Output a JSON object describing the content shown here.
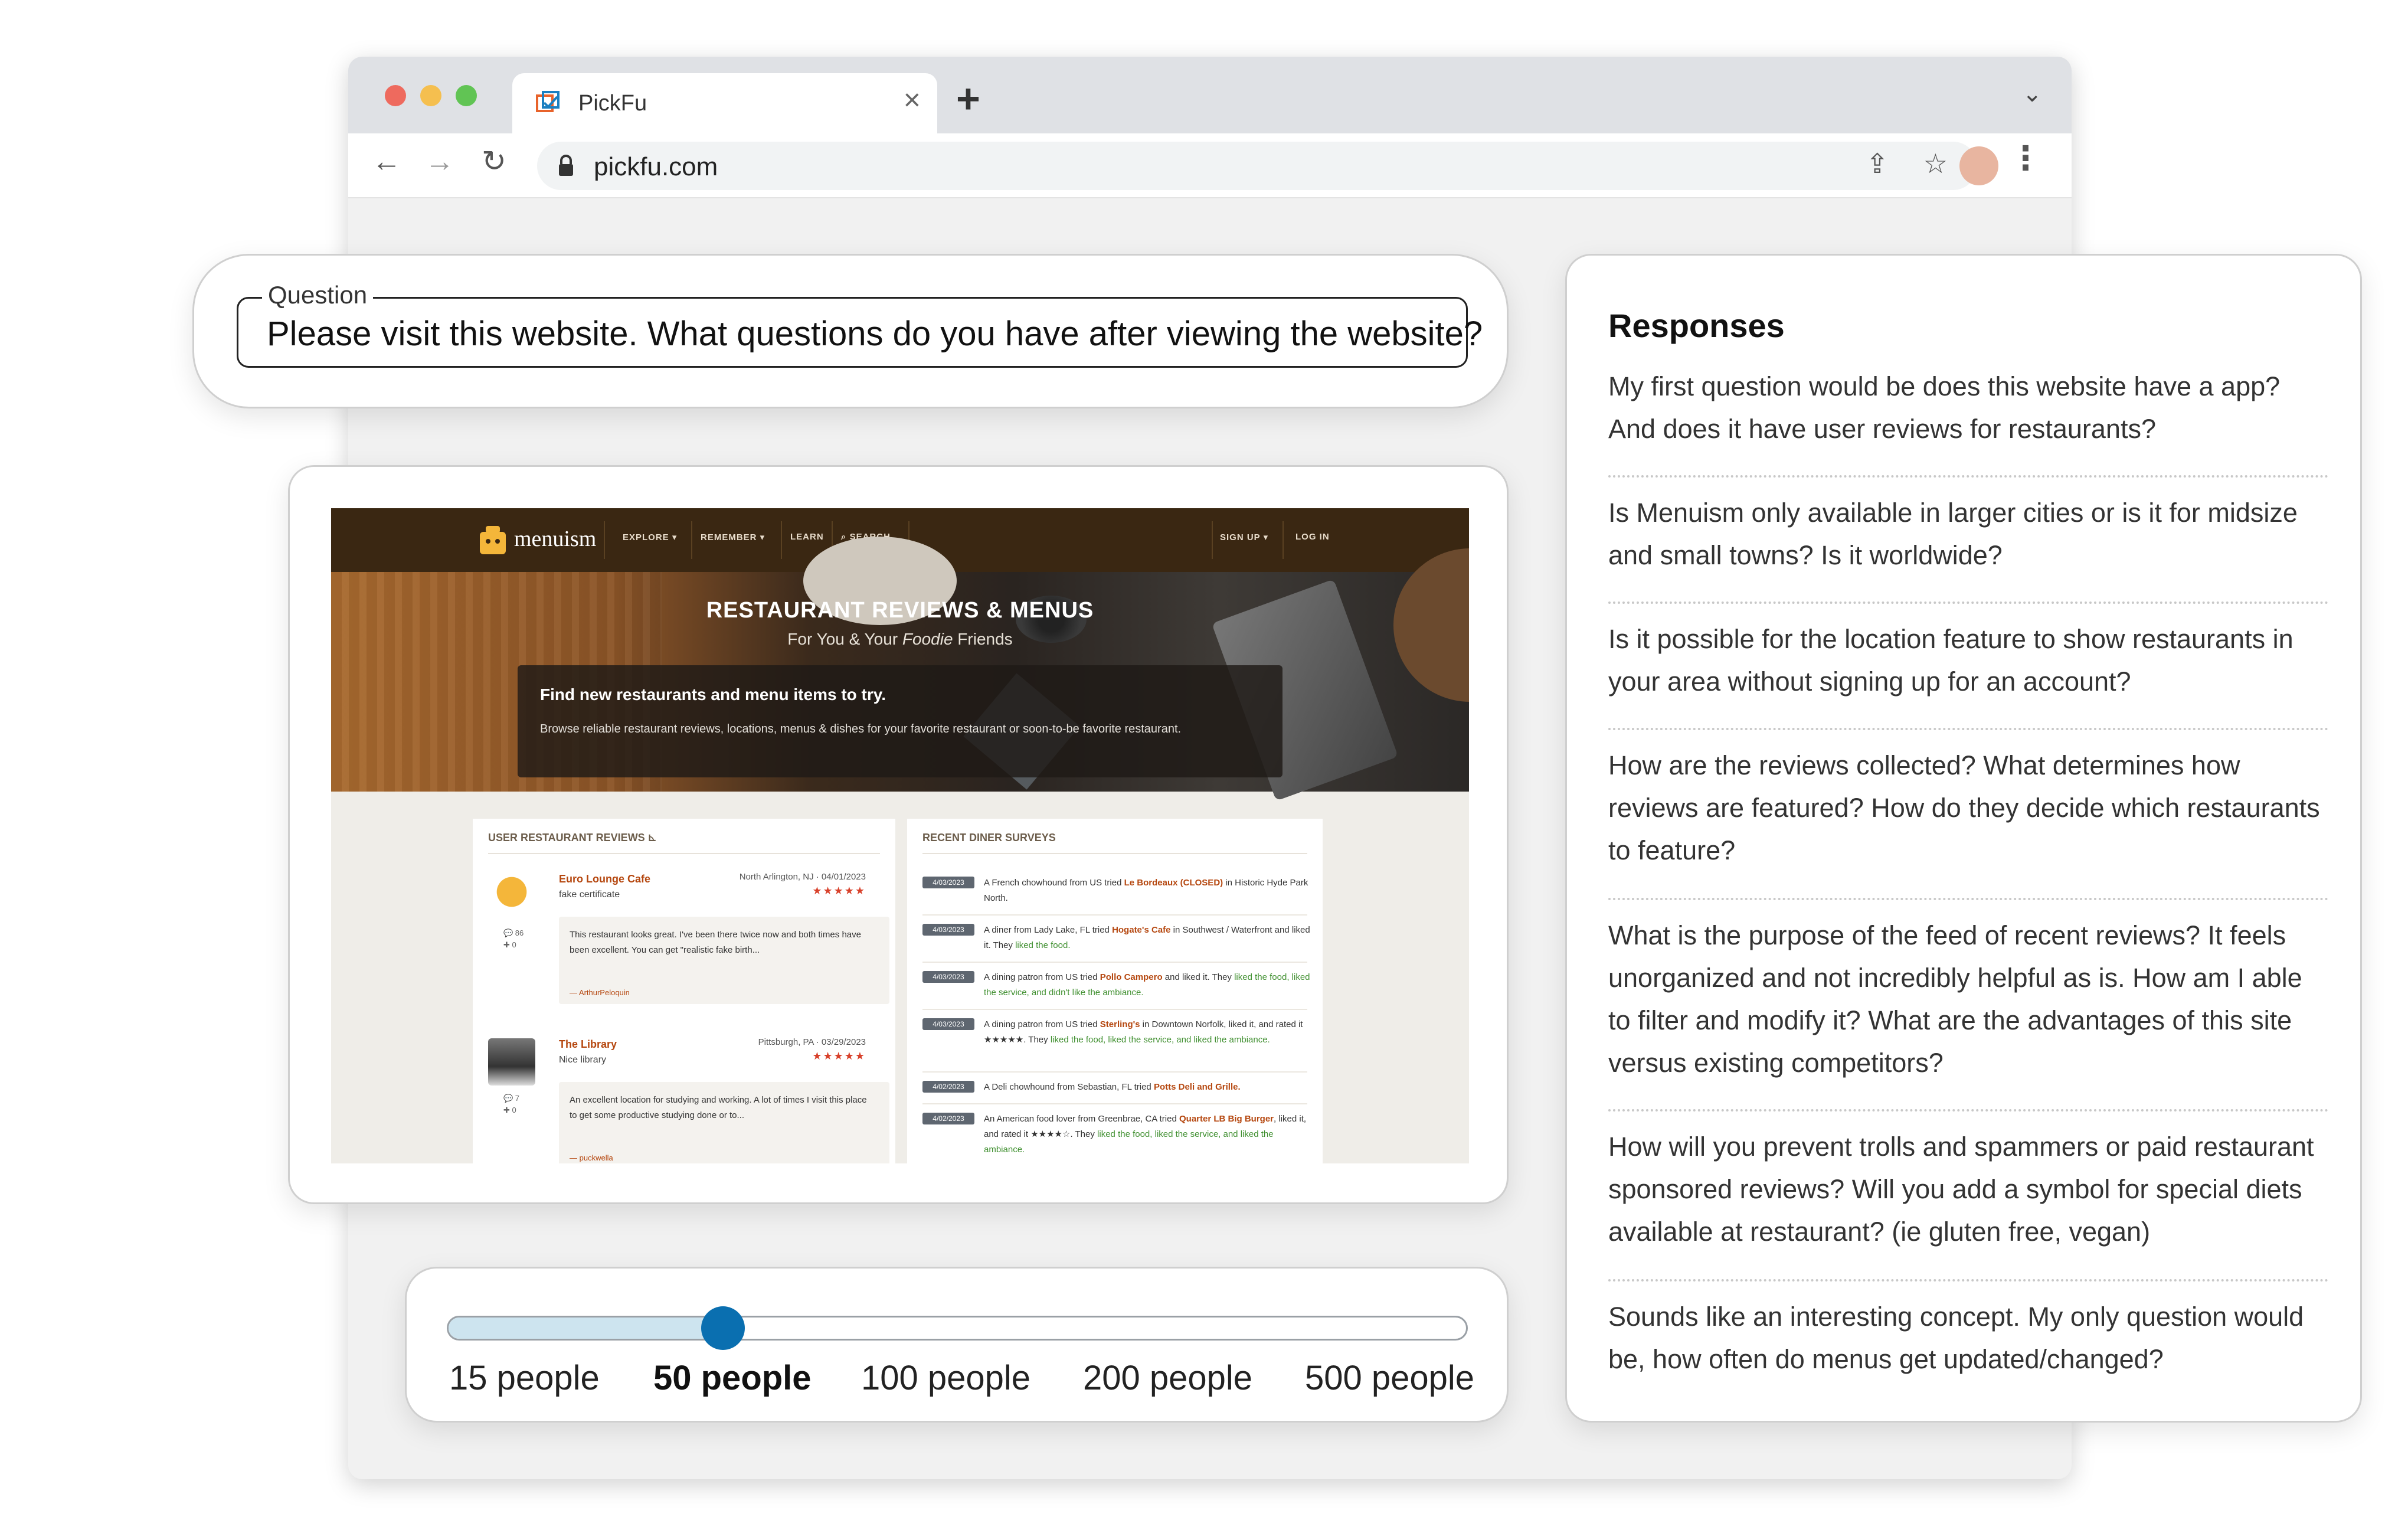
{
  "browser": {
    "tab_title": "PickFu",
    "url": "pickfu.com",
    "icons": [
      "close-icon",
      "plus-icon",
      "chevron-down-icon",
      "back-arrow-icon",
      "forward-arrow-icon",
      "reload-icon",
      "lock-icon",
      "share-icon",
      "star-icon",
      "kebab-menu-icon"
    ]
  },
  "question": {
    "legend": "Question",
    "text": "Please visit this website. What questions do you have after viewing the website?"
  },
  "site": {
    "logo": "menuism",
    "nav": [
      "EXPLORE ▾",
      "REMEMBER ▾",
      "LEARN",
      "⌕ SEARCH"
    ],
    "nav_right": [
      "SIGN UP ▾",
      "LOG IN"
    ],
    "hero_title": "RESTAURANT REVIEWS & MENUS",
    "hero_sub_pre": "For You & Your ",
    "hero_sub_em": "Foodie",
    "hero_sub_post": " Friends",
    "hero_box_title": "Find new restaurants and menu items to try.",
    "hero_box_text": "Browse reliable restaurant reviews, locations, menus & dishes for your favorite restaurant or soon-to-be favorite restaurant.",
    "left_panel_title": "USER RESTAURANT REVIEWS ⊾",
    "right_panel_title": "RECENT DINER SURVEYS",
    "reviews": [
      {
        "name": "Euro Lounge Cafe",
        "location": "North Arlington, NJ · 04/01/2023",
        "stars": "★★★★★",
        "tag": "fake certificate",
        "stats": "💬 86\n✚ 0",
        "text": "This restaurant looks great. I've been there twice now and both times have been excellent. You can get \"realistic fake birth...",
        "author": "— ArthurPeloquin"
      },
      {
        "name": "The Library",
        "location": "Pittsburgh, PA · 03/29/2023",
        "stars": "★★★★★",
        "tag": "Nice library",
        "stats": "💬 7\n✚ 0",
        "text": "An excellent location for studying and working. A lot of times I visit this place to get some productive studying done or to...",
        "author": "— puckwella"
      }
    ],
    "surveys": [
      {
        "date": "4/03/2023",
        "pre": "A French chowhound from US tried ",
        "place": "Le Bordeaux (CLOSED)",
        "post": " in Historic Hyde Park North.",
        "extra": ""
      },
      {
        "date": "4/03/2023",
        "pre": "A diner from Lady Lake, FL tried ",
        "place": "Hogate's Cafe",
        "post": " in Southwest / Waterfront and liked it. They ",
        "extra": "liked the food."
      },
      {
        "date": "4/03/2023",
        "pre": "A dining patron from US tried ",
        "place": "Pollo Campero",
        "post": " and liked it. They ",
        "extra": "liked the food, liked the service, and didn't like the ambiance."
      },
      {
        "date": "4/03/2023",
        "pre": "A dining patron from US tried ",
        "place": "Sterling's",
        "post": " in Downtown Norfolk, liked it, and rated it ★★★★★. They ",
        "extra": "liked the food, liked the service, and liked the ambiance."
      },
      {
        "date": "4/02/2023",
        "pre": "A Deli chowhound from Sebastian, FL tried ",
        "place": "Potts Deli and Grille.",
        "post": "",
        "extra": ""
      },
      {
        "date": "4/02/2023",
        "pre": "An American food lover from Greenbrae, CA tried ",
        "place": "Quarter LB Big Burger",
        "post": ", liked it, and rated it ★★★★☆. They ",
        "extra": "liked the food, liked the service, and liked the ambiance."
      }
    ]
  },
  "slider": {
    "options": [
      "15 people",
      "50 people",
      "100 people",
      "200 people",
      "500 people"
    ],
    "selected_index": 1,
    "fill_fraction": 0.27,
    "accent": "#0a6fb0",
    "fill_color": "#cde4ef"
  },
  "responses": {
    "title": "Responses",
    "items": [
      "My first question would be does this website have a app? And does it have user reviews for restaurants?",
      "Is Menuism only available in larger cities or is it for midsize and small towns? Is it worldwide?",
      "Is it possible for the location feature to show restaurants in your area without signing up for an account?",
      "How are the reviews collected? What determines how reviews are featured? How do they decide which restaurants to feature?",
      "What is the purpose of the feed of recent reviews? It feels unorganized and not incredibly helpful as is. How am I able to filter and modify it? What are the advantages of this site versus existing competitors?",
      "How will you prevent trolls and spammers or paid restaurant sponsored reviews? Will you add a symbol for special diets available at restaurant? (ie gluten free, vegan)",
      "Sounds like an interesting concept. My only question would be, how often do menus get updated/changed?"
    ]
  }
}
